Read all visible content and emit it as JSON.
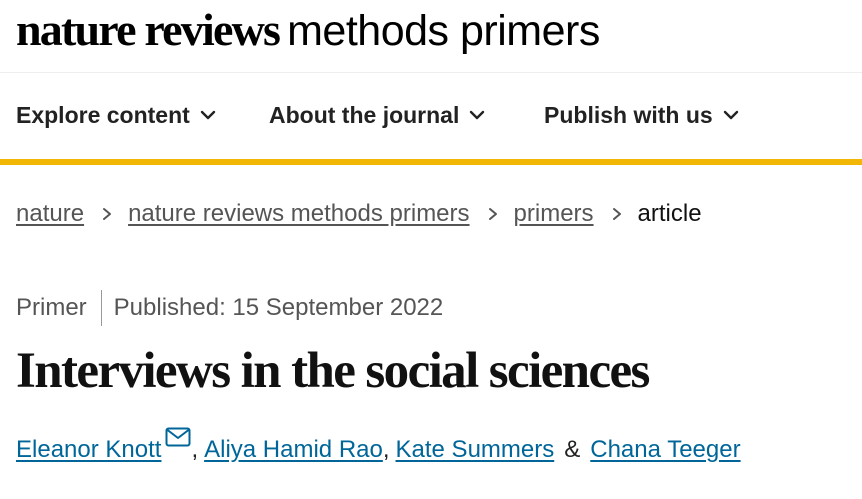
{
  "logo": {
    "brand": "nature reviews",
    "product": "methods primers"
  },
  "nav": {
    "items": [
      {
        "label": "Explore content",
        "icon": "chevron-down-icon"
      },
      {
        "label": "About the journal",
        "icon": "chevron-down-icon"
      },
      {
        "label": "Publish with us",
        "icon": "chevron-down-icon"
      }
    ],
    "accent_color": "#f2b705"
  },
  "breadcrumb": {
    "items": [
      "nature",
      "nature reviews methods primers",
      "primers"
    ],
    "current": "article",
    "separator_icon": "chevron-right-icon"
  },
  "article": {
    "type": "Primer",
    "published": "Published: 15 September 2022",
    "title": "Interviews in the social sciences"
  },
  "authors": {
    "list": [
      "Eleanor Knott",
      "Aliya Hamid Rao",
      "Kate Summers",
      "Chana Teeger"
    ],
    "comma": ",",
    "ampersand": "&",
    "contact_icon": "mail-icon",
    "link_color": "#006699"
  }
}
